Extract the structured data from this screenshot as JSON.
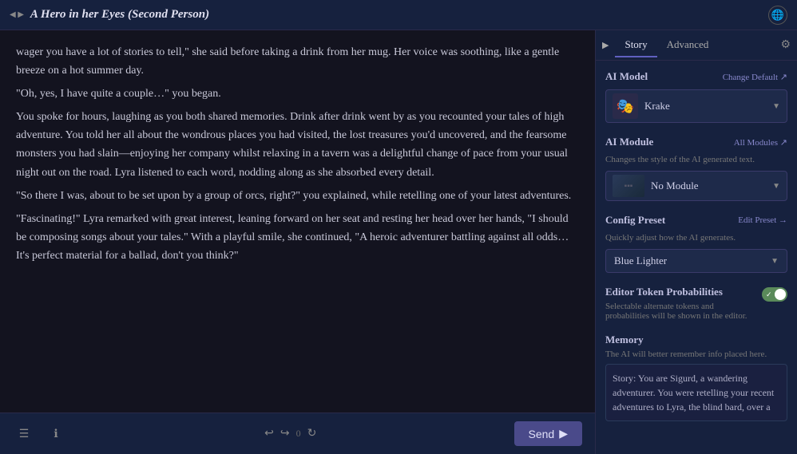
{
  "topbar": {
    "title": "A Hero in her Eyes (Second Person)",
    "globe_icon": "🌐"
  },
  "story": {
    "paragraphs": [
      "wager you have a lot of stories to tell,\" she said before taking a drink from her mug. Her voice was soothing, like a gentle breeze on a hot summer day.",
      "\"Oh, yes, I have quite a couple…\" you began.",
      "You spoke for hours, laughing as you both shared memories. Drink after drink went by as you recounted your tales of high adventure. You told her all about the wondrous places you had visited, the lost treasures you'd uncovered, and the fearsome monsters you had slain—enjoying her company whilst relaxing in a tavern was a delightful change of pace from your usual night out on the road. Lyra listened to each word, nodding along as she absorbed every detail.",
      "\"So there I was, about to be set upon by a group of orcs, right?\" you explained, while retelling one of your latest adventures.",
      "\"Fascinating!\" Lyra remarked with great interest, leaning forward on her seat and resting her head over her hands, \"I should be composing songs about your tales.\" With a playful smile, she continued, \"A heroic adventurer battling against all odds… It's perfect material for a ballad, don't you think?\""
    ]
  },
  "toolbar": {
    "send_label": "Send",
    "send_icon": "▶",
    "undo_label": "↩",
    "redo_label": "↪",
    "undo_count": "0",
    "redo_icon": "↻",
    "edit_icon": "☰",
    "info_icon": "ℹ"
  },
  "sidebar": {
    "tabs": {
      "story_label": "Story",
      "advanced_label": "Advanced"
    },
    "ai_model": {
      "title": "AI Model",
      "change_link": "Change Default ↗",
      "model_name": "Krake",
      "avatar_icon": "🎭"
    },
    "ai_module": {
      "title": "AI Module",
      "all_modules_link": "All Modules ↗",
      "description": "Changes the style of the AI generated text.",
      "module_name": "No Module"
    },
    "config_preset": {
      "title": "Config Preset",
      "edit_link": "Edit Preset →",
      "description": "Quickly adjust how the AI generates.",
      "preset_name": "Blue Lighter"
    },
    "token_probabilities": {
      "title": "Editor Token Probabilities",
      "description": "Selectable alternate tokens and probabilities will be shown in the editor.",
      "enabled": true
    },
    "memory": {
      "title": "Memory",
      "description": "The AI will better remember info placed here.",
      "text": "Story: You are Sigurd, a wandering adventurer. You were retelling your recent adventures to Lyra, the blind bard, over a"
    }
  }
}
